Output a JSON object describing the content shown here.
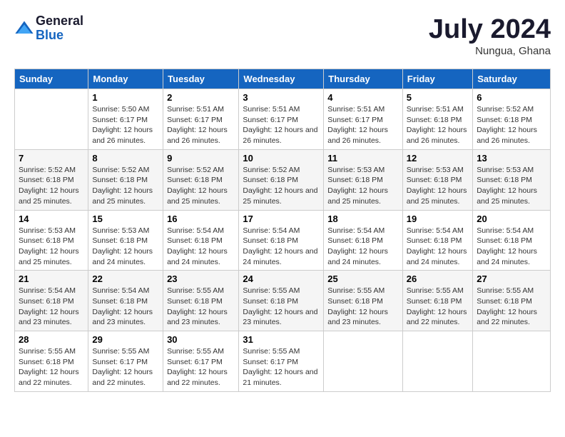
{
  "header": {
    "logo_line1": "General",
    "logo_line2": "Blue",
    "month": "July 2024",
    "location": "Nungua, Ghana"
  },
  "days_of_week": [
    "Sunday",
    "Monday",
    "Tuesday",
    "Wednesday",
    "Thursday",
    "Friday",
    "Saturday"
  ],
  "weeks": [
    [
      {
        "day": "",
        "sunrise": "",
        "sunset": "",
        "daylight": ""
      },
      {
        "day": "1",
        "sunrise": "Sunrise: 5:50 AM",
        "sunset": "Sunset: 6:17 PM",
        "daylight": "Daylight: 12 hours and 26 minutes."
      },
      {
        "day": "2",
        "sunrise": "Sunrise: 5:51 AM",
        "sunset": "Sunset: 6:17 PM",
        "daylight": "Daylight: 12 hours and 26 minutes."
      },
      {
        "day": "3",
        "sunrise": "Sunrise: 5:51 AM",
        "sunset": "Sunset: 6:17 PM",
        "daylight": "Daylight: 12 hours and 26 minutes."
      },
      {
        "day": "4",
        "sunrise": "Sunrise: 5:51 AM",
        "sunset": "Sunset: 6:17 PM",
        "daylight": "Daylight: 12 hours and 26 minutes."
      },
      {
        "day": "5",
        "sunrise": "Sunrise: 5:51 AM",
        "sunset": "Sunset: 6:18 PM",
        "daylight": "Daylight: 12 hours and 26 minutes."
      },
      {
        "day": "6",
        "sunrise": "Sunrise: 5:52 AM",
        "sunset": "Sunset: 6:18 PM",
        "daylight": "Daylight: 12 hours and 26 minutes."
      }
    ],
    [
      {
        "day": "7",
        "sunrise": "Sunrise: 5:52 AM",
        "sunset": "Sunset: 6:18 PM",
        "daylight": "Daylight: 12 hours and 25 minutes."
      },
      {
        "day": "8",
        "sunrise": "Sunrise: 5:52 AM",
        "sunset": "Sunset: 6:18 PM",
        "daylight": "Daylight: 12 hours and 25 minutes."
      },
      {
        "day": "9",
        "sunrise": "Sunrise: 5:52 AM",
        "sunset": "Sunset: 6:18 PM",
        "daylight": "Daylight: 12 hours and 25 minutes."
      },
      {
        "day": "10",
        "sunrise": "Sunrise: 5:52 AM",
        "sunset": "Sunset: 6:18 PM",
        "daylight": "Daylight: 12 hours and 25 minutes."
      },
      {
        "day": "11",
        "sunrise": "Sunrise: 5:53 AM",
        "sunset": "Sunset: 6:18 PM",
        "daylight": "Daylight: 12 hours and 25 minutes."
      },
      {
        "day": "12",
        "sunrise": "Sunrise: 5:53 AM",
        "sunset": "Sunset: 6:18 PM",
        "daylight": "Daylight: 12 hours and 25 minutes."
      },
      {
        "day": "13",
        "sunrise": "Sunrise: 5:53 AM",
        "sunset": "Sunset: 6:18 PM",
        "daylight": "Daylight: 12 hours and 25 minutes."
      }
    ],
    [
      {
        "day": "14",
        "sunrise": "Sunrise: 5:53 AM",
        "sunset": "Sunset: 6:18 PM",
        "daylight": "Daylight: 12 hours and 25 minutes."
      },
      {
        "day": "15",
        "sunrise": "Sunrise: 5:53 AM",
        "sunset": "Sunset: 6:18 PM",
        "daylight": "Daylight: 12 hours and 24 minutes."
      },
      {
        "day": "16",
        "sunrise": "Sunrise: 5:54 AM",
        "sunset": "Sunset: 6:18 PM",
        "daylight": "Daylight: 12 hours and 24 minutes."
      },
      {
        "day": "17",
        "sunrise": "Sunrise: 5:54 AM",
        "sunset": "Sunset: 6:18 PM",
        "daylight": "Daylight: 12 hours and 24 minutes."
      },
      {
        "day": "18",
        "sunrise": "Sunrise: 5:54 AM",
        "sunset": "Sunset: 6:18 PM",
        "daylight": "Daylight: 12 hours and 24 minutes."
      },
      {
        "day": "19",
        "sunrise": "Sunrise: 5:54 AM",
        "sunset": "Sunset: 6:18 PM",
        "daylight": "Daylight: 12 hours and 24 minutes."
      },
      {
        "day": "20",
        "sunrise": "Sunrise: 5:54 AM",
        "sunset": "Sunset: 6:18 PM",
        "daylight": "Daylight: 12 hours and 24 minutes."
      }
    ],
    [
      {
        "day": "21",
        "sunrise": "Sunrise: 5:54 AM",
        "sunset": "Sunset: 6:18 PM",
        "daylight": "Daylight: 12 hours and 23 minutes."
      },
      {
        "day": "22",
        "sunrise": "Sunrise: 5:54 AM",
        "sunset": "Sunset: 6:18 PM",
        "daylight": "Daylight: 12 hours and 23 minutes."
      },
      {
        "day": "23",
        "sunrise": "Sunrise: 5:55 AM",
        "sunset": "Sunset: 6:18 PM",
        "daylight": "Daylight: 12 hours and 23 minutes."
      },
      {
        "day": "24",
        "sunrise": "Sunrise: 5:55 AM",
        "sunset": "Sunset: 6:18 PM",
        "daylight": "Daylight: 12 hours and 23 minutes."
      },
      {
        "day": "25",
        "sunrise": "Sunrise: 5:55 AM",
        "sunset": "Sunset: 6:18 PM",
        "daylight": "Daylight: 12 hours and 23 minutes."
      },
      {
        "day": "26",
        "sunrise": "Sunrise: 5:55 AM",
        "sunset": "Sunset: 6:18 PM",
        "daylight": "Daylight: 12 hours and 22 minutes."
      },
      {
        "day": "27",
        "sunrise": "Sunrise: 5:55 AM",
        "sunset": "Sunset: 6:18 PM",
        "daylight": "Daylight: 12 hours and 22 minutes."
      }
    ],
    [
      {
        "day": "28",
        "sunrise": "Sunrise: 5:55 AM",
        "sunset": "Sunset: 6:18 PM",
        "daylight": "Daylight: 12 hours and 22 minutes."
      },
      {
        "day": "29",
        "sunrise": "Sunrise: 5:55 AM",
        "sunset": "Sunset: 6:17 PM",
        "daylight": "Daylight: 12 hours and 22 minutes."
      },
      {
        "day": "30",
        "sunrise": "Sunrise: 5:55 AM",
        "sunset": "Sunset: 6:17 PM",
        "daylight": "Daylight: 12 hours and 22 minutes."
      },
      {
        "day": "31",
        "sunrise": "Sunrise: 5:55 AM",
        "sunset": "Sunset: 6:17 PM",
        "daylight": "Daylight: 12 hours and 21 minutes."
      },
      {
        "day": "",
        "sunrise": "",
        "sunset": "",
        "daylight": ""
      },
      {
        "day": "",
        "sunrise": "",
        "sunset": "",
        "daylight": ""
      },
      {
        "day": "",
        "sunrise": "",
        "sunset": "",
        "daylight": ""
      }
    ]
  ]
}
